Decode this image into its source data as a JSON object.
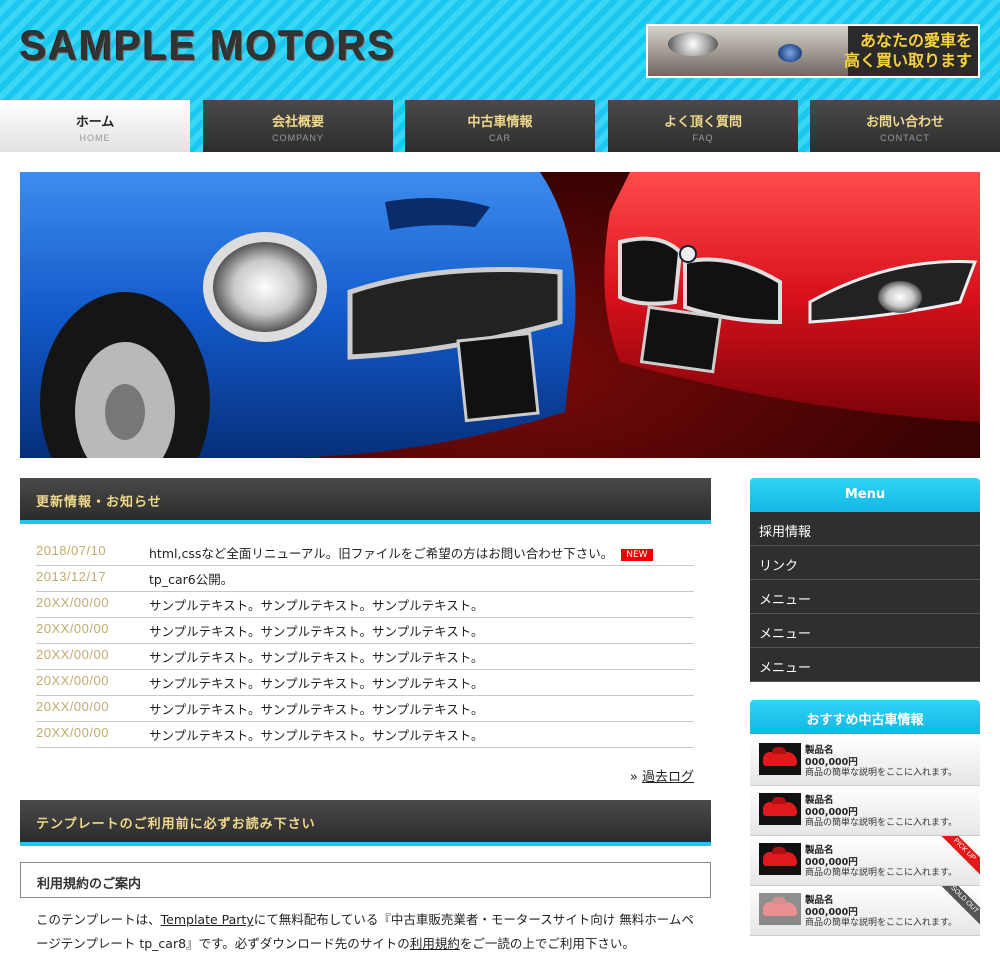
{
  "header": {
    "logo": "SAMPLE MOTORS",
    "banner_line1": "あなたの愛車を",
    "banner_line2": "高く買い取ります"
  },
  "nav": [
    {
      "label": "ホーム",
      "sub": "HOME",
      "active": true
    },
    {
      "label": "会社概要",
      "sub": "COMPANY"
    },
    {
      "label": "中古車情報",
      "sub": "CAR"
    },
    {
      "label": "よく頂く質問",
      "sub": "FAQ"
    },
    {
      "label": "お問い合わせ",
      "sub": "CONTACT"
    }
  ],
  "news": {
    "heading": "更新情報・お知らせ",
    "items": [
      {
        "date": "2018/07/10",
        "text": "html,cssなど全面リニューアル。旧ファイルをご希望の方はお問い合わせ下さい。",
        "badge": "NEW"
      },
      {
        "date": "2013/12/17",
        "text": "tp_car6公開。"
      },
      {
        "date": "20XX/00/00",
        "text": "サンプルテキスト。サンプルテキスト。サンプルテキスト。"
      },
      {
        "date": "20XX/00/00",
        "text": "サンプルテキスト。サンプルテキスト。サンプルテキスト。"
      },
      {
        "date": "20XX/00/00",
        "text": "サンプルテキスト。サンプルテキスト。サンプルテキスト。"
      },
      {
        "date": "20XX/00/00",
        "text": "サンプルテキスト。サンプルテキスト。サンプルテキスト。"
      },
      {
        "date": "20XX/00/00",
        "text": "サンプルテキスト。サンプルテキスト。サンプルテキスト。"
      },
      {
        "date": "20XX/00/00",
        "text": "サンプルテキスト。サンプルテキスト。サンプルテキスト。"
      }
    ],
    "archive_prefix": "»",
    "archive_link": "過去ログ"
  },
  "template_section": {
    "heading": "テンプレートのご利用前に必ずお読み下さい",
    "subheading": "利用規約のご案内",
    "text_part1": "このテンプレートは、",
    "link1": "Template Party",
    "text_part2": "にて無料配布している『中古車販売業者・モータースサイト向け 無料ホームページテンプレート tp_car8』です。必ずダウンロード先のサイトの",
    "link2": "利用規約",
    "text_part3": "をご一読の上でご利用下さい。"
  },
  "sidebar": {
    "menu_heading": "Menu",
    "menu_items": [
      "採用情報",
      "リンク",
      "メニュー",
      "メニュー",
      "メニュー"
    ],
    "rec_heading": "おすすめ中古車情報",
    "rec_items": [
      {
        "name": "製品名",
        "price": "000,000円",
        "desc": "商品の簡単な説明をここに入れます。"
      },
      {
        "name": "製品名",
        "price": "000,000円",
        "desc": "商品の簡単な説明をここに入れます。"
      },
      {
        "name": "製品名",
        "price": "000,000円",
        "desc": "商品の簡単な説明をここに入れます。",
        "ribbon": "PICK UP"
      },
      {
        "name": "製品名",
        "price": "000,000円",
        "desc": "商品の簡単な説明をここに入れます。",
        "ribbon": "SOLD OUT"
      }
    ]
  },
  "colors": {
    "accent": "#1cc7ef",
    "nav_text": "#f0d98a",
    "date": "#c2ab6e",
    "new_badge": "#ee0000"
  }
}
